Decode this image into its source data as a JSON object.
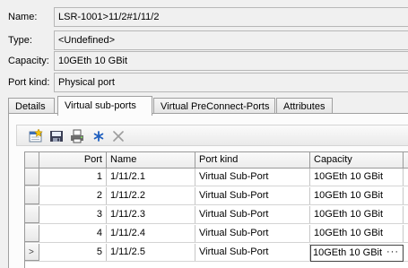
{
  "fields": {
    "name": {
      "label": "Name:",
      "value": "LSR-1001>11/2#1/11/2"
    },
    "type": {
      "label": "Type:",
      "value": "<Undefined>"
    },
    "capacity": {
      "label": "Capacity:",
      "value": "10GEth 10 GBit"
    },
    "port_kind": {
      "label": "Port kind:",
      "value": "Physical port"
    }
  },
  "tabs": [
    {
      "label": "Details"
    },
    {
      "label": "Virtual sub-ports",
      "active": true
    },
    {
      "label": "Virtual PreConnect-Ports"
    },
    {
      "label": "Attributes"
    }
  ],
  "toolbar": {
    "icons": [
      "new-record-icon",
      "save-icon",
      "print-icon",
      "star-icon",
      "delete-icon"
    ]
  },
  "grid": {
    "columns": [
      "Port",
      "Name",
      "Port kind",
      "Capacity"
    ],
    "rows": [
      {
        "port": "1",
        "name": "1/11/2.1",
        "port_kind": "Virtual Sub-Port",
        "capacity": "10GEth 10 GBit"
      },
      {
        "port": "2",
        "name": "1/11/2.2",
        "port_kind": "Virtual Sub-Port",
        "capacity": "10GEth 10 GBit"
      },
      {
        "port": "3",
        "name": "1/11/2.3",
        "port_kind": "Virtual Sub-Port",
        "capacity": "10GEth 10 GBit"
      },
      {
        "port": "4",
        "name": "1/11/2.4",
        "port_kind": "Virtual Sub-Port",
        "capacity": "10GEth 10 GBit"
      },
      {
        "port": "5",
        "name": "1/11/2.5",
        "port_kind": "Virtual Sub-Port",
        "capacity": "10GEth 10 GBit"
      }
    ],
    "current_row_marker": ">",
    "ellipsis_button": "···"
  }
}
